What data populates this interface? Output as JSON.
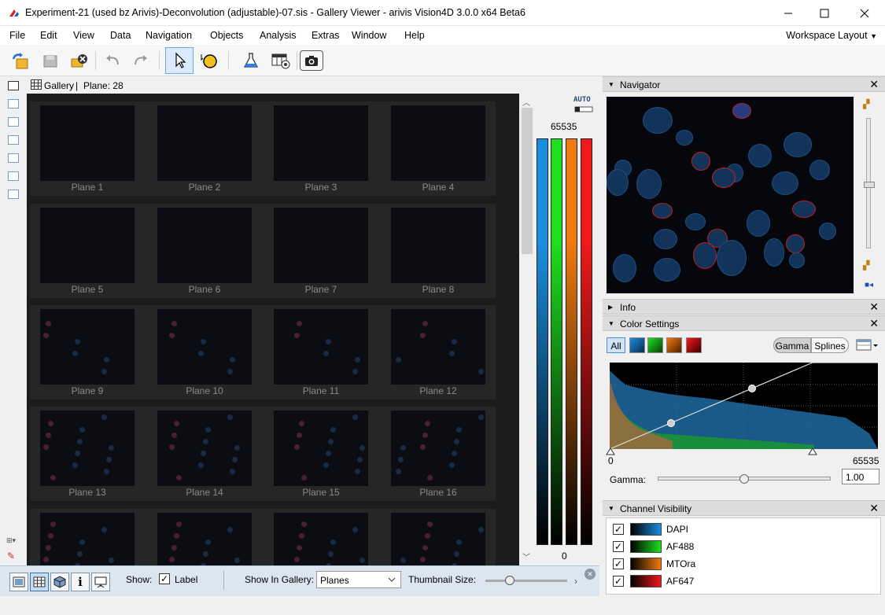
{
  "window": {
    "title": "Experiment-21 (used bz Arivis)-Deconvolution (adjustable)-07.sis - Gallery Viewer - arivis Vision4D 3.0.0 x64 Beta6",
    "minimize": "—",
    "maximize": "☐",
    "close": "✕"
  },
  "menu": {
    "items": [
      "File",
      "Edit",
      "View",
      "Data",
      "Navigation",
      "Objects",
      "Analysis",
      "Extras",
      "Window",
      "Help"
    ],
    "workspace_layout": "Workspace Layout"
  },
  "gallery": {
    "header_label": "Gallery",
    "separator": "|",
    "plane_text": "Plane: 28",
    "planes": [
      "Plane 1",
      "Plane 2",
      "Plane 3",
      "Plane 4",
      "Plane 5",
      "Plane 6",
      "Plane 7",
      "Plane 8",
      "Plane 9",
      "Plane 10",
      "Plane 11",
      "Plane 12",
      "Plane 13",
      "Plane 14",
      "Plane 15",
      "Plane 16"
    ]
  },
  "channel_bars": {
    "auto_label": "AUTO",
    "max_value": "65535",
    "min_value": "0",
    "colors": [
      "#1a8fe0",
      "#1ee01e",
      "#f07a10",
      "#f01a1a"
    ]
  },
  "navigator": {
    "title": "Navigator"
  },
  "info": {
    "title": "Info"
  },
  "color_settings": {
    "title": "Color Settings",
    "all_label": "All",
    "gamma_tab": "Gamma",
    "splines_tab": "Splines",
    "hist_min": "0",
    "hist_max": "65535",
    "gamma_label": "Gamma:",
    "gamma_value": "1.00",
    "gamma_slider_fraction": 0.5
  },
  "channel_visibility": {
    "title": "Channel Visibility",
    "channels": [
      {
        "name": "DAPI",
        "checked": true,
        "color": "#1a8fe0"
      },
      {
        "name": "AF488",
        "checked": true,
        "color": "#1ee01e"
      },
      {
        "name": "MTOra",
        "checked": true,
        "color": "#f07a10"
      },
      {
        "name": "AF647",
        "checked": true,
        "color": "#f01a1a"
      }
    ]
  },
  "bottom_bar": {
    "show_label": "Show:",
    "label_checkbox": "Label",
    "label_checked": true,
    "show_in_gallery_label": "Show In Gallery:",
    "show_in_gallery_value": "Planes",
    "thumbnail_size_label": "Thumbnail Size:",
    "thumbnail_size_fraction": 0.3
  }
}
